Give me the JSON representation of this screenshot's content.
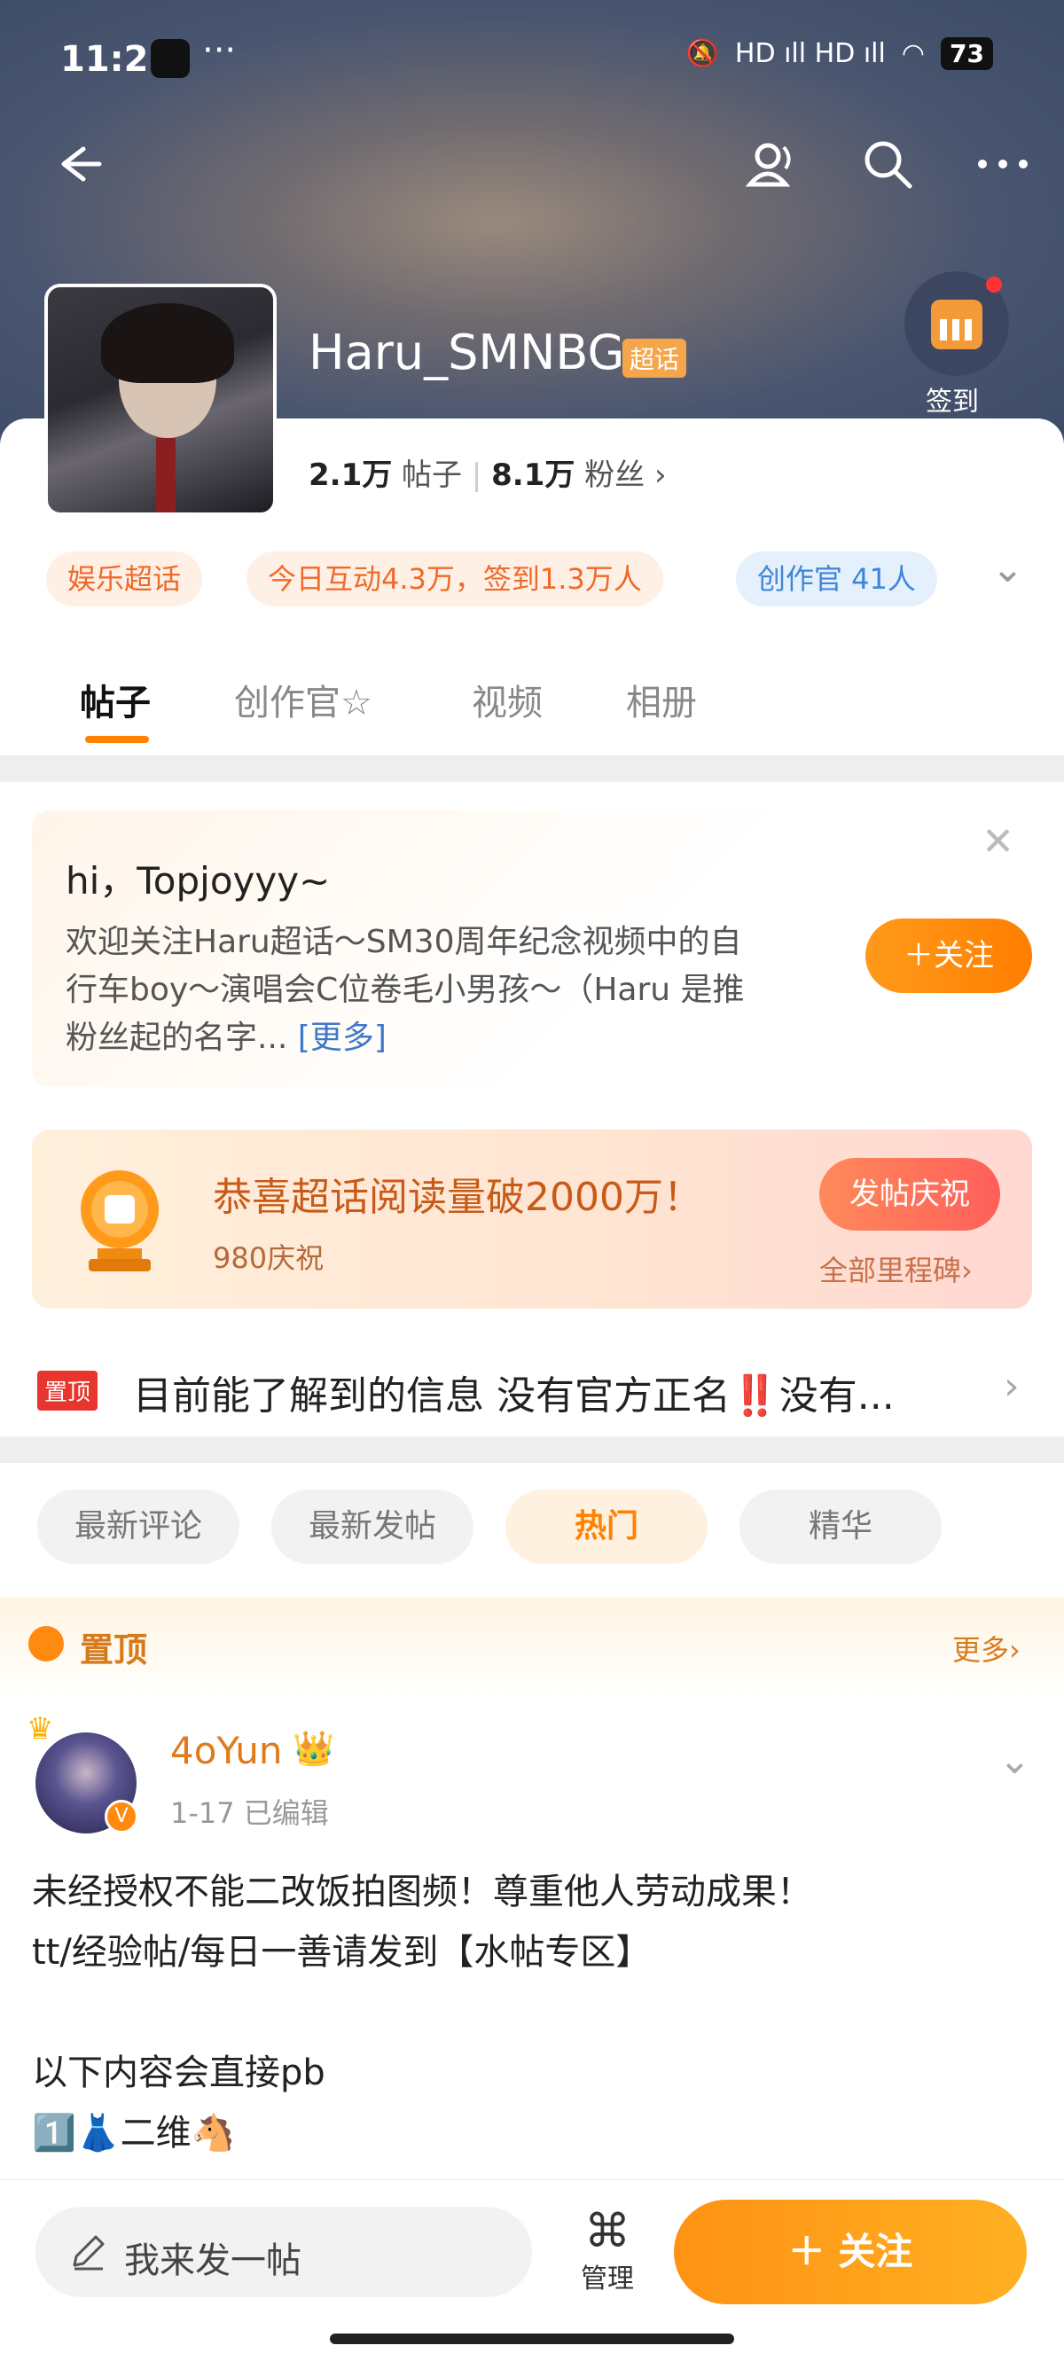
{
  "status": {
    "time": "11:21",
    "dots": "···",
    "signal": "HD ıll HD ıll",
    "battery": "73"
  },
  "header": {
    "name": "Haru_SMNBG",
    "tag": "超话",
    "checkin_label": "签到",
    "stats": {
      "posts_value": "2.1万",
      "posts_label": "帖子",
      "fans_value": "8.1万",
      "fans_label": "粉丝",
      "fans_chevron": "›"
    }
  },
  "pills": {
    "category": "娱乐超话",
    "today": "今日互动4.3万，签到1.3万人",
    "creators": "创作官 41人",
    "expand": "⌄"
  },
  "tabs": [
    {
      "label": "帖子"
    },
    {
      "label": "创作官"
    },
    {
      "label": "视频"
    },
    {
      "label": "相册"
    }
  ],
  "welcome": {
    "greeting": "hi，Topjoyyy~",
    "desc": "欢迎关注Haru超话～SM30周年纪念视频中的自行车boy～演唱会C位卷毛小男孩～（Haru 是推粉丝起的名字...",
    "more": "[更多]",
    "close": "✕",
    "follow": "＋关注"
  },
  "milestone": {
    "title": "恭喜超话阅读量破2000万！",
    "count": "980庆祝",
    "button": "发帖庆祝",
    "all": "全部里程碑›"
  },
  "pinned": {
    "tag": "置顶",
    "text": "目前能了解到的信息 没有官方正名‼️没有...",
    "chevron": "›"
  },
  "filters": [
    {
      "label": "最新评论"
    },
    {
      "label": "最新发帖"
    },
    {
      "label": "热门"
    },
    {
      "label": "精华"
    }
  ],
  "zhiding": {
    "label": "置顶",
    "more": "更多›"
  },
  "post": {
    "user": "4oYun",
    "badge": "👑",
    "meta": "1-17  已编辑",
    "v": "V",
    "body": "未经授权不能二改饭拍图频！尊重他人劳动成果！\ntt/经验帖/每日一善请发到【水帖专区】\n\n以下内容会直接pb\n1️⃣👗二维🐴"
  },
  "bottom": {
    "compose_placeholder": "我来发一帖",
    "manage_label": "管理",
    "follow": "＋ 关注"
  },
  "colors": {
    "accent": "#ff8200",
    "hero": "#4a5670"
  }
}
